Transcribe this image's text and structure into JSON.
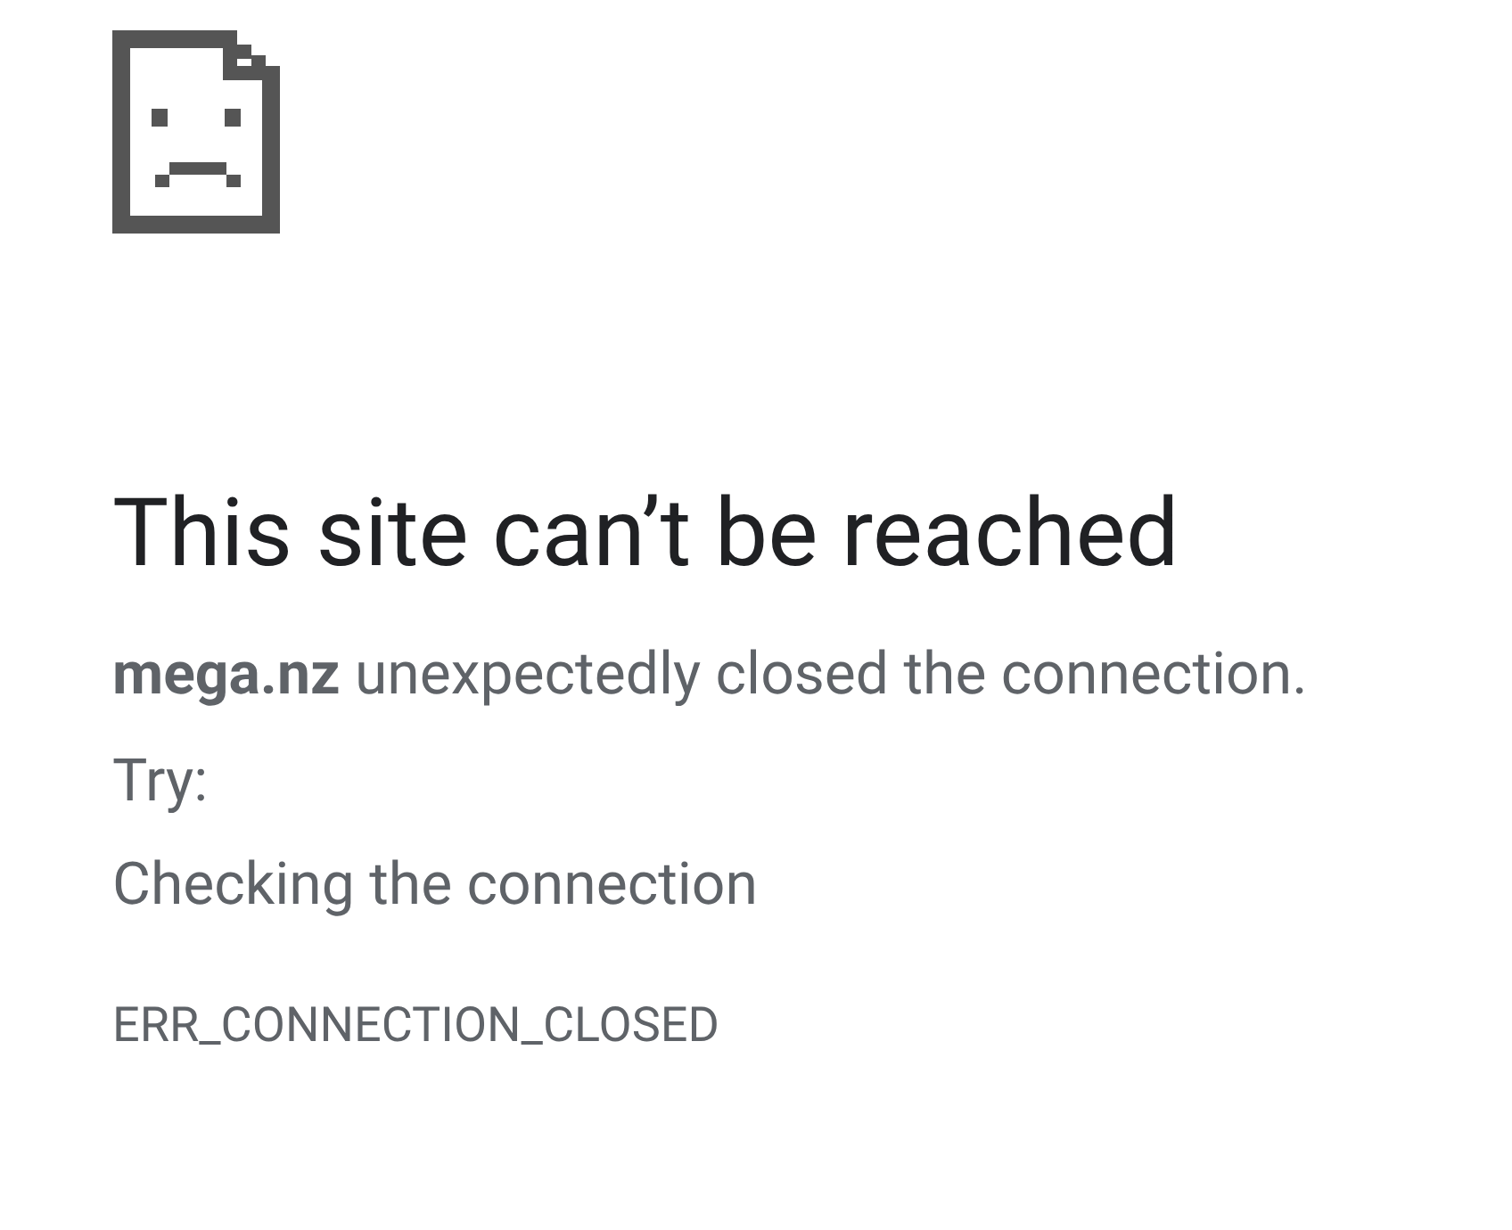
{
  "error_page": {
    "title": "This site can’t be reached",
    "message": "**mega.nz** unexpectedly closed the connection.",
    "try_label": "Try:",
    "suggestions": [
      "Checking the connection"
    ],
    "error_code": "ERR_CONNECTION_CLOSED"
  }
}
